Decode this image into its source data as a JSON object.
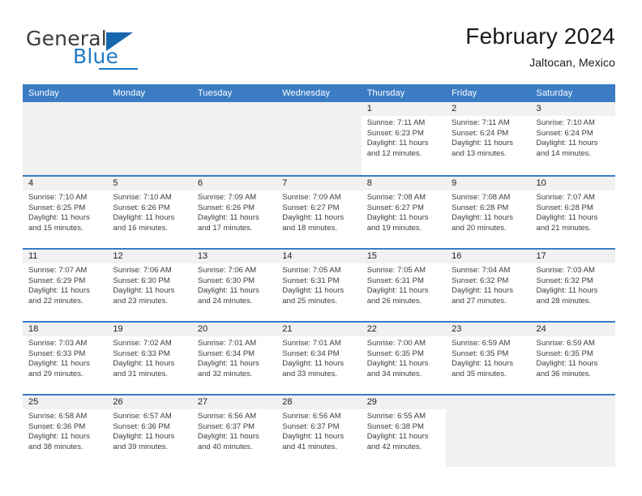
{
  "brand": {
    "name_part1": "General",
    "name_part2": "Blue",
    "flag_icon": "blue-triangle-flag-icon",
    "accent_color": "#1f7ac4"
  },
  "header": {
    "title": "February 2024",
    "subtitle": "Jaltocan, Mexico"
  },
  "theme": {
    "header_blue": "#3b7cc4",
    "band_gray": "#f1f1f1",
    "text_dark": "#231f20"
  },
  "weekdays": [
    "Sunday",
    "Monday",
    "Tuesday",
    "Wednesday",
    "Thursday",
    "Friday",
    "Saturday"
  ],
  "weeks": [
    [
      {
        "day": "",
        "l1": "",
        "l2": "",
        "l3": "",
        "l4": "",
        "empty": true
      },
      {
        "day": "",
        "l1": "",
        "l2": "",
        "l3": "",
        "l4": "",
        "empty": true
      },
      {
        "day": "",
        "l1": "",
        "l2": "",
        "l3": "",
        "l4": "",
        "empty": true
      },
      {
        "day": "",
        "l1": "",
        "l2": "",
        "l3": "",
        "l4": "",
        "empty": true
      },
      {
        "day": "1",
        "l1": "Sunrise: 7:11 AM",
        "l2": "Sunset: 6:23 PM",
        "l3": "Daylight: 11 hours",
        "l4": "and 12 minutes."
      },
      {
        "day": "2",
        "l1": "Sunrise: 7:11 AM",
        "l2": "Sunset: 6:24 PM",
        "l3": "Daylight: 11 hours",
        "l4": "and 13 minutes."
      },
      {
        "day": "3",
        "l1": "Sunrise: 7:10 AM",
        "l2": "Sunset: 6:24 PM",
        "l3": "Daylight: 11 hours",
        "l4": "and 14 minutes."
      }
    ],
    [
      {
        "day": "4",
        "l1": "Sunrise: 7:10 AM",
        "l2": "Sunset: 6:25 PM",
        "l3": "Daylight: 11 hours",
        "l4": "and 15 minutes."
      },
      {
        "day": "5",
        "l1": "Sunrise: 7:10 AM",
        "l2": "Sunset: 6:26 PM",
        "l3": "Daylight: 11 hours",
        "l4": "and 16 minutes."
      },
      {
        "day": "6",
        "l1": "Sunrise: 7:09 AM",
        "l2": "Sunset: 6:26 PM",
        "l3": "Daylight: 11 hours",
        "l4": "and 17 minutes."
      },
      {
        "day": "7",
        "l1": "Sunrise: 7:09 AM",
        "l2": "Sunset: 6:27 PM",
        "l3": "Daylight: 11 hours",
        "l4": "and 18 minutes."
      },
      {
        "day": "8",
        "l1": "Sunrise: 7:08 AM",
        "l2": "Sunset: 6:27 PM",
        "l3": "Daylight: 11 hours",
        "l4": "and 19 minutes."
      },
      {
        "day": "9",
        "l1": "Sunrise: 7:08 AM",
        "l2": "Sunset: 6:28 PM",
        "l3": "Daylight: 11 hours",
        "l4": "and 20 minutes."
      },
      {
        "day": "10",
        "l1": "Sunrise: 7:07 AM",
        "l2": "Sunset: 6:28 PM",
        "l3": "Daylight: 11 hours",
        "l4": "and 21 minutes."
      }
    ],
    [
      {
        "day": "11",
        "l1": "Sunrise: 7:07 AM",
        "l2": "Sunset: 6:29 PM",
        "l3": "Daylight: 11 hours",
        "l4": "and 22 minutes."
      },
      {
        "day": "12",
        "l1": "Sunrise: 7:06 AM",
        "l2": "Sunset: 6:30 PM",
        "l3": "Daylight: 11 hours",
        "l4": "and 23 minutes."
      },
      {
        "day": "13",
        "l1": "Sunrise: 7:06 AM",
        "l2": "Sunset: 6:30 PM",
        "l3": "Daylight: 11 hours",
        "l4": "and 24 minutes."
      },
      {
        "day": "14",
        "l1": "Sunrise: 7:05 AM",
        "l2": "Sunset: 6:31 PM",
        "l3": "Daylight: 11 hours",
        "l4": "and 25 minutes."
      },
      {
        "day": "15",
        "l1": "Sunrise: 7:05 AM",
        "l2": "Sunset: 6:31 PM",
        "l3": "Daylight: 11 hours",
        "l4": "and 26 minutes."
      },
      {
        "day": "16",
        "l1": "Sunrise: 7:04 AM",
        "l2": "Sunset: 6:32 PM",
        "l3": "Daylight: 11 hours",
        "l4": "and 27 minutes."
      },
      {
        "day": "17",
        "l1": "Sunrise: 7:03 AM",
        "l2": "Sunset: 6:32 PM",
        "l3": "Daylight: 11 hours",
        "l4": "and 28 minutes."
      }
    ],
    [
      {
        "day": "18",
        "l1": "Sunrise: 7:03 AM",
        "l2": "Sunset: 6:33 PM",
        "l3": "Daylight: 11 hours",
        "l4": "and 29 minutes."
      },
      {
        "day": "19",
        "l1": "Sunrise: 7:02 AM",
        "l2": "Sunset: 6:33 PM",
        "l3": "Daylight: 11 hours",
        "l4": "and 31 minutes."
      },
      {
        "day": "20",
        "l1": "Sunrise: 7:01 AM",
        "l2": "Sunset: 6:34 PM",
        "l3": "Daylight: 11 hours",
        "l4": "and 32 minutes."
      },
      {
        "day": "21",
        "l1": "Sunrise: 7:01 AM",
        "l2": "Sunset: 6:34 PM",
        "l3": "Daylight: 11 hours",
        "l4": "and 33 minutes."
      },
      {
        "day": "22",
        "l1": "Sunrise: 7:00 AM",
        "l2": "Sunset: 6:35 PM",
        "l3": "Daylight: 11 hours",
        "l4": "and 34 minutes."
      },
      {
        "day": "23",
        "l1": "Sunrise: 6:59 AM",
        "l2": "Sunset: 6:35 PM",
        "l3": "Daylight: 11 hours",
        "l4": "and 35 minutes."
      },
      {
        "day": "24",
        "l1": "Sunrise: 6:59 AM",
        "l2": "Sunset: 6:35 PM",
        "l3": "Daylight: 11 hours",
        "l4": "and 36 minutes."
      }
    ],
    [
      {
        "day": "25",
        "l1": "Sunrise: 6:58 AM",
        "l2": "Sunset: 6:36 PM",
        "l3": "Daylight: 11 hours",
        "l4": "and 38 minutes."
      },
      {
        "day": "26",
        "l1": "Sunrise: 6:57 AM",
        "l2": "Sunset: 6:36 PM",
        "l3": "Daylight: 11 hours",
        "l4": "and 39 minutes."
      },
      {
        "day": "27",
        "l1": "Sunrise: 6:56 AM",
        "l2": "Sunset: 6:37 PM",
        "l3": "Daylight: 11 hours",
        "l4": "and 40 minutes."
      },
      {
        "day": "28",
        "l1": "Sunrise: 6:56 AM",
        "l2": "Sunset: 6:37 PM",
        "l3": "Daylight: 11 hours",
        "l4": "and 41 minutes."
      },
      {
        "day": "29",
        "l1": "Sunrise: 6:55 AM",
        "l2": "Sunset: 6:38 PM",
        "l3": "Daylight: 11 hours",
        "l4": "and 42 minutes."
      },
      {
        "day": "",
        "l1": "",
        "l2": "",
        "l3": "",
        "l4": "",
        "empty": true
      },
      {
        "day": "",
        "l1": "",
        "l2": "",
        "l3": "",
        "l4": "",
        "empty": true
      }
    ]
  ]
}
